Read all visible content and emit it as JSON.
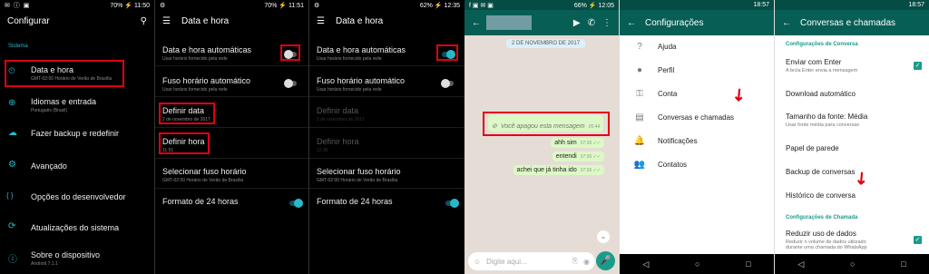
{
  "p1": {
    "status": {
      "icons": "✉ ⓘ ▣",
      "right": "70% ⚡ 11:50"
    },
    "title": "Configurar",
    "section": "Sistema",
    "items": [
      {
        "icon": "⏲",
        "title": "Data e hora",
        "sub": "GMT-02:00 Horário de Verão de Brasília"
      },
      {
        "icon": "⊕",
        "title": "Idiomas e entrada",
        "sub": "Português (Brasil)"
      },
      {
        "icon": "☁",
        "title": "Fazer backup e redefinir",
        "sub": ""
      },
      {
        "icon": "⚙",
        "title": "Avançado",
        "sub": ""
      },
      {
        "icon": "{ }",
        "title": "Opções do desenvolvedor",
        "sub": ""
      },
      {
        "icon": "⟳",
        "title": "Atualizações do sistema",
        "sub": ""
      },
      {
        "icon": "ⓘ",
        "title": "Sobre o dispositivo",
        "sub": "Android 7.1.1"
      }
    ]
  },
  "p2": {
    "status": {
      "icons": "⚙",
      "right": "70% ⚡ 11:51"
    },
    "title": "Data e hora",
    "items": [
      {
        "title": "Data e hora automáticas",
        "sub": "Usar horário fornecido pela rede"
      },
      {
        "title": "Fuso horário automático",
        "sub": "Usar horário fornecido pela rede"
      },
      {
        "title": "Definir data",
        "sub": "2 de novembro de 2017"
      },
      {
        "title": "Definir hora",
        "sub": "11:51"
      },
      {
        "title": "Selecionar fuso horário",
        "sub": "GMT-02:00 Horário de Verão de Brasília"
      },
      {
        "title": "Formato de 24 horas",
        "sub": ""
      }
    ]
  },
  "p3": {
    "status": {
      "icons": "⚙",
      "right": "62% ⚡ 12:35"
    },
    "title": "Data e hora",
    "items": [
      {
        "title": "Data e hora automáticas",
        "sub": "Usar horário fornecido pela rede"
      },
      {
        "title": "Fuso horário automático",
        "sub": "Usar horário fornecido pela rede"
      },
      {
        "title": "Definir data",
        "sub": "2 de novembro de 2017"
      },
      {
        "title": "Definir hora",
        "sub": "12:35"
      },
      {
        "title": "Selecionar fuso horário",
        "sub": "GMT-02:00 Horário de Verão de Brasília"
      },
      {
        "title": "Formato de 24 horas",
        "sub": ""
      }
    ]
  },
  "p4": {
    "status": {
      "icons": "f ▣ ✉ ▣",
      "right": "66% ⚡ 12:05"
    },
    "date_chip": "2 DE NOVEMBRO DE 2017",
    "deleted": {
      "text": "Você apagou esta mensagem",
      "time": "05:44"
    },
    "messages": [
      {
        "text": "ahh sim",
        "time": "07:36 ✓✓"
      },
      {
        "text": "entendi",
        "time": "07:36 ✓✓"
      },
      {
        "text": "achei que já tinha ido",
        "time": "07:36 ✓✓"
      }
    ],
    "input_placeholder": "Digite aqui..."
  },
  "p5": {
    "status": {
      "icons": "",
      "right": "18:57"
    },
    "title": "Configurações",
    "items": [
      {
        "icon": "?",
        "label": "Ajuda"
      },
      {
        "icon": "●",
        "label": "Perfil"
      },
      {
        "icon": "⚿",
        "label": "Conta"
      },
      {
        "icon": "▤",
        "label": "Conversas e chamadas"
      },
      {
        "icon": "🔔",
        "label": "Notificações"
      },
      {
        "icon": "👥",
        "label": "Contatos"
      }
    ]
  },
  "p6": {
    "status": {
      "icons": "",
      "right": "18:57"
    },
    "title": "Conversas e chamadas",
    "sec1": "Configurações de Conversa",
    "items": [
      {
        "title": "Enviar com Enter",
        "sub": "A tecla Enter envia a mensagem"
      },
      {
        "title": "Download automático",
        "sub": ""
      },
      {
        "title": "Tamanho da fonte: Média",
        "sub": "Usar fonte média para conversas"
      },
      {
        "title": "Papel de parede",
        "sub": ""
      },
      {
        "title": "Backup de conversas",
        "sub": ""
      },
      {
        "title": "Histórico de conversa",
        "sub": ""
      }
    ],
    "sec2": "Configurações de Chamada",
    "data_item": {
      "title": "Reduzir uso de dados",
      "sub1": "Reduzir o volume de dados utilizado",
      "sub2": "durante uma chamada do WhatsApp"
    }
  },
  "nav": {
    "back": "◁",
    "home": "○",
    "recent": "□"
  },
  "colors": {
    "accent_red": "#e00012",
    "whatsapp_green": "#075e54",
    "teal": "#1a9c8c"
  }
}
